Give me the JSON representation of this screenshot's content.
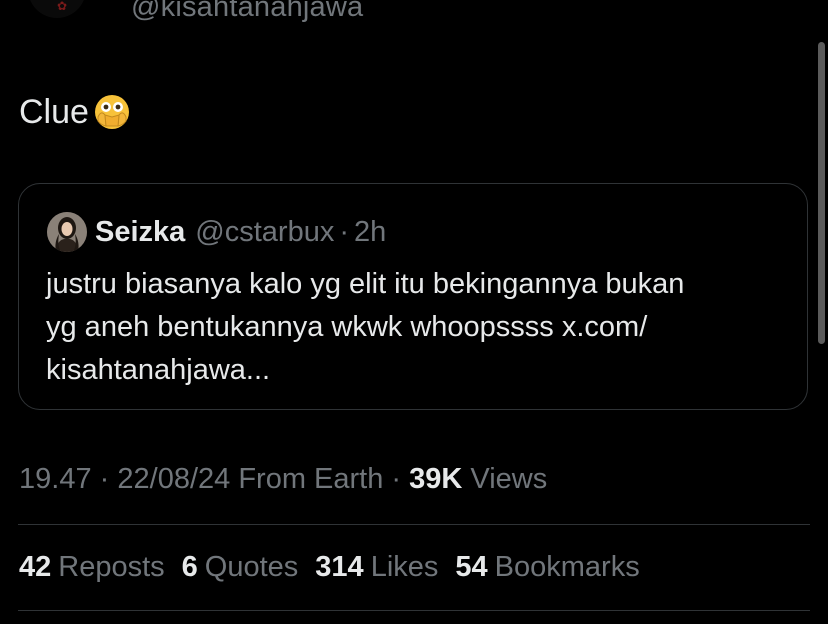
{
  "author": {
    "handle": "@kisahtanahjawa",
    "avatar_icon": "profile-avatar"
  },
  "tweet": {
    "text": "Clue",
    "emoji_icon": "face-with-open-eyes-and-hand-over-mouth-emoji"
  },
  "quote": {
    "avatar_icon": "profile-avatar",
    "name": "Seizka",
    "handle": "@cstarbux",
    "separator": "·",
    "time": "2h",
    "lines": [
      "justru biasanya kalo yg elit itu bekingannya bukan",
      "yg aneh bentukannya wkwk whoopssss x.com/",
      "kisahtanahjawa..."
    ]
  },
  "meta": {
    "time": "19.47",
    "sep1": "·",
    "date": "22/08/24",
    "source": "From Earth",
    "sep2": "·",
    "views_count": "39K",
    "views_label": "Views"
  },
  "stats": [
    {
      "count": "42",
      "label": "Reposts"
    },
    {
      "count": "6",
      "label": "Quotes"
    },
    {
      "count": "314",
      "label": "Likes"
    },
    {
      "count": "54",
      "label": "Bookmarks"
    }
  ],
  "colors": {
    "background": "#000000",
    "primary_text": "#e7e9ea",
    "secondary_text": "#71767b",
    "border": "#2f3336"
  }
}
